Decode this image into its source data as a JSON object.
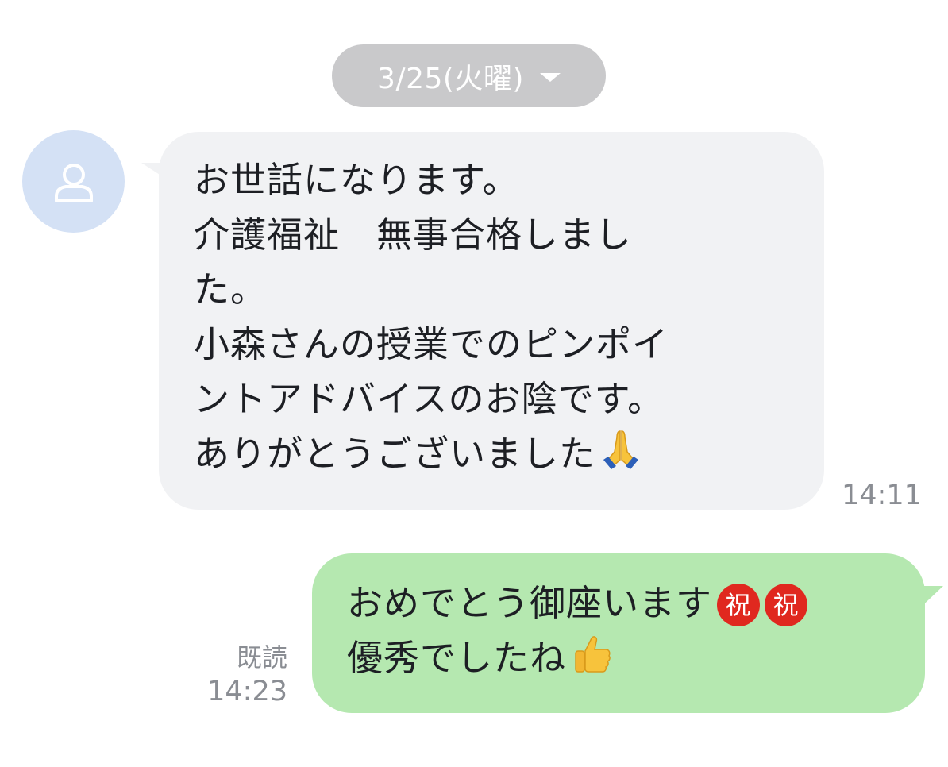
{
  "date_pill": {
    "label": "3/25(火曜)",
    "icon": "chevron-down-icon"
  },
  "incoming": {
    "avatar_icon": "person-icon",
    "lines": [
      "お世話になります。",
      "介護福祉　無事合格しまし",
      "た。",
      "小森さんの授業でのピンポイ",
      "ントアドバイスのお陰です。",
      "ありがとうございました"
    ],
    "emoji": "🙏",
    "emoji_icon": "folded-hands-emoji",
    "time": "14:11"
  },
  "outgoing": {
    "line1": "おめでとう御座います",
    "badge_char": "祝",
    "badge_icon": "congratulation-ideograph-icon",
    "line2": "優秀でしたね",
    "emoji": "👍",
    "emoji_icon": "thumbs-up-emoji",
    "read_label": "既読",
    "time": "14:23"
  },
  "colors": {
    "incoming_bubble": "#f1f2f4",
    "outgoing_bubble": "#b5e8b0",
    "date_pill": "#c9c9cb",
    "avatar_bg": "#d4e1f5",
    "badge": "#e0281f"
  }
}
